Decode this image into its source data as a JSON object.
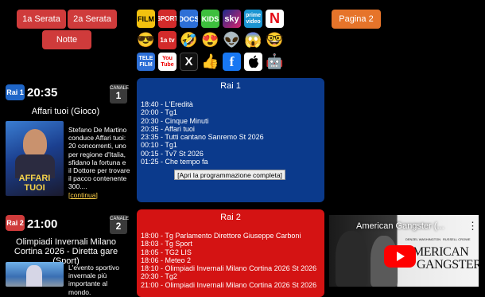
{
  "nav": {
    "serata1": "1a Serata",
    "serata2": "2a Serata",
    "notte": "Notte",
    "pagina2": "Pagina 2"
  },
  "icons_row1": [
    {
      "label": "FILM",
      "bg": "#f3c20f",
      "fg": "#000"
    },
    {
      "label": "SPORT",
      "bg": "#d32b2b",
      "fg": "#fff"
    },
    {
      "label": "DOCS",
      "bg": "#2d6fd6",
      "fg": "#fff"
    },
    {
      "label": "KIDS",
      "bg": "#3dbf3d",
      "fg": "#fff"
    },
    {
      "label": "sky",
      "bg": "#1c2a8c",
      "fg": "#fff"
    },
    {
      "label": "prime video",
      "bg": "#1b95d2",
      "fg": "#fff"
    },
    {
      "label": "N",
      "bg": "#fff",
      "fg": "#e50914"
    }
  ],
  "icons_row2": [
    "😎",
    "1a tv",
    "🤣",
    "😍",
    "👽",
    "😱",
    "🤓"
  ],
  "icons_row3": [
    "TELE FILM",
    "You Tube",
    "X",
    "👍",
    "f",
    "",
    "🤖"
  ],
  "channels": [
    {
      "logo": "Rai 1",
      "time": "20:35",
      "canale_label": "CANALE",
      "canale_num": "1",
      "show": "Affari tuoi (Gioco)",
      "thumb_text": "AFFARI TUOI",
      "description": "Stefano De Martino conduce Affari tuoi: 20 concorrenti, uno per regione d'Italia, sfidano la fortuna e il Dottore per trovare il pacco contenente 300....",
      "more": "[continua]",
      "panel_title": "Rai 1",
      "schedule": [
        "18:40 - L'Eredità",
        "20:00 - Tg1",
        "20:30 - Cinque Minuti",
        "20:35 - Affari tuoi",
        "23:35 - Tutti cantano Sanremo St 2026",
        "00:10 - Tg1",
        "00:15 - Tv7 St 2026",
        "01:25 - Che tempo fa"
      ],
      "full_link": "[Apri la programmazione completa]"
    },
    {
      "logo": "Rai 2",
      "time": "21:00",
      "canale_label": "CANALE",
      "canale_num": "2",
      "show": "Olimpiadi Invernali Milano Cortina 2026 - Diretta gare (Sport)",
      "description": "L'evento sportivo invernale più importante al mondo.",
      "panel_title": "Rai 2",
      "schedule": [
        "18:00 - Tg Parlamento Direttore Giuseppe Carboni",
        "18:03 - Tg Sport",
        "18:05 - TG2 LIS",
        "18:06 - Meteo 2",
        "18:10 - Olimpiadi Invernali Milano Cortina 2026 St 2026",
        "20:30 - Tg2",
        "21:00 - Olimpiadi Invernali Milano Cortina 2026 St 2026"
      ]
    }
  ],
  "video": {
    "title": "American Gangster (...",
    "menu": "⋮",
    "credit_left": "DENZEL WASHINGTON",
    "credit_right": "RUSSELL CROWE",
    "poster_line1": "AMERICAN",
    "poster_line2": "GANGSTER"
  },
  "colors": {
    "red_button": "#cf3b3b",
    "orange_button": "#e6742a",
    "rai1_panel": "#0b3a8c",
    "rai2_panel": "#d41313",
    "rai_logo": "#1f66c8"
  }
}
